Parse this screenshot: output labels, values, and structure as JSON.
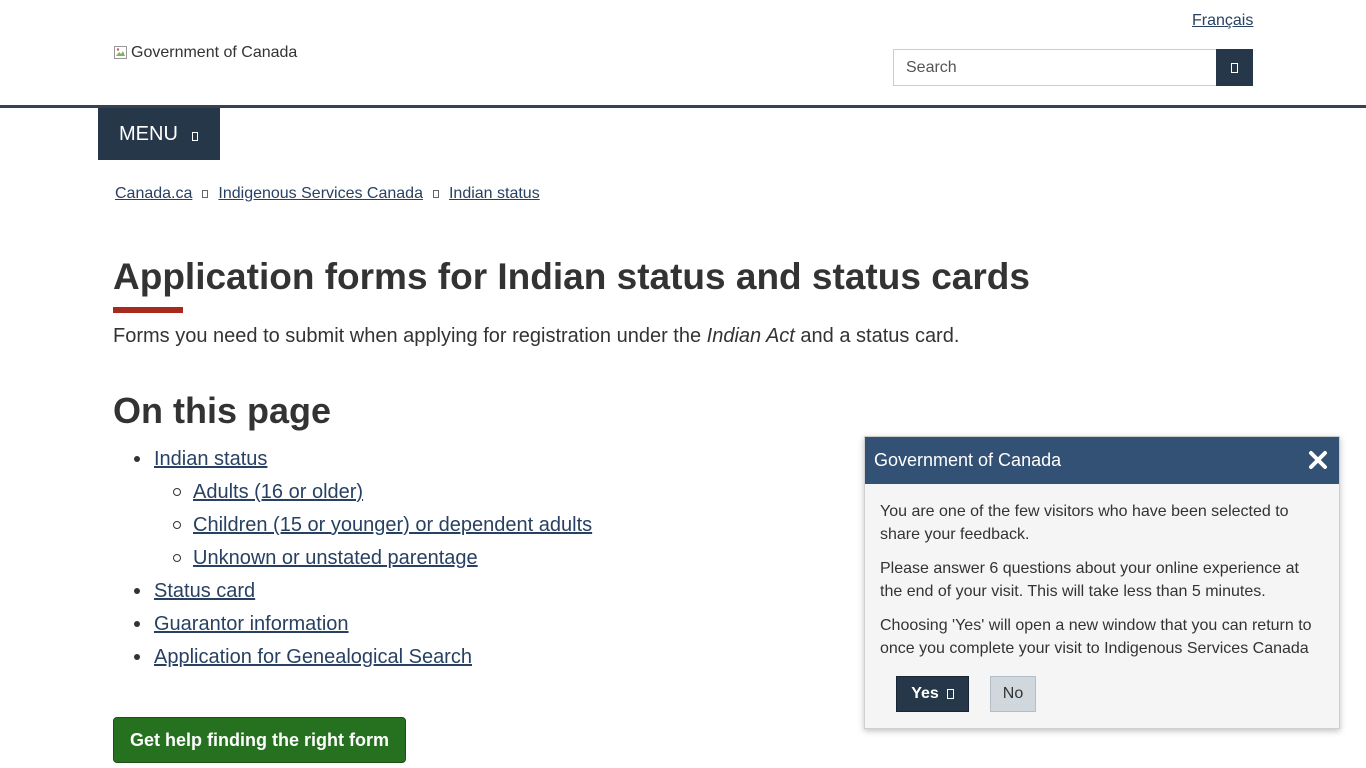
{
  "header": {
    "language_link": "Français",
    "logo_alt": "Government of Canada",
    "search": {
      "placeholder": "Search",
      "value": ""
    },
    "menu_label": "MENU"
  },
  "breadcrumb": [
    "Canada.ca",
    "Indigenous Services Canada",
    "Indian status"
  ],
  "main": {
    "title": "Application forms for Indian status and status cards",
    "lead_before": "Forms you need to submit when applying for registration under the ",
    "lead_italic": "Indian Act",
    "lead_after": " and a status card.",
    "on_this_page_heading": "On this page",
    "toc": {
      "indian_status": "Indian status",
      "adults": "Adults (16 or older)",
      "children": "Children (15 or younger) or dependent adults",
      "unknown": "Unknown or unstated parentage",
      "status_card": "Status card",
      "guarantor": "Guarantor information",
      "genealogical": "Application for Genealogical Search"
    },
    "help_button": "Get help finding the right form"
  },
  "feedback": {
    "title": "Government of Canada",
    "paragraph_1": "You are one of the few visitors who have been selected to share your feedback.",
    "paragraph_2": "Please answer 6 questions about your online experience at the end of your visit. This will take less than 5 minutes.",
    "paragraph_3": "Choosing 'Yes' will open a new window that you can return to once you complete your visit to Indigenous Services Canada",
    "yes_label": "Yes",
    "no_label": "No"
  },
  "colors": {
    "navy": "#26374a",
    "link": "#284162",
    "accent_red": "#a62a1e",
    "green_button": "#26711f",
    "feedback_header": "#335075"
  },
  "icons": {
    "search_button": "search-icon",
    "menu": "expand-icon",
    "breadcrumb_separator": "chevron-right-icon",
    "close": "close-icon",
    "yes": "external-link-icon"
  }
}
